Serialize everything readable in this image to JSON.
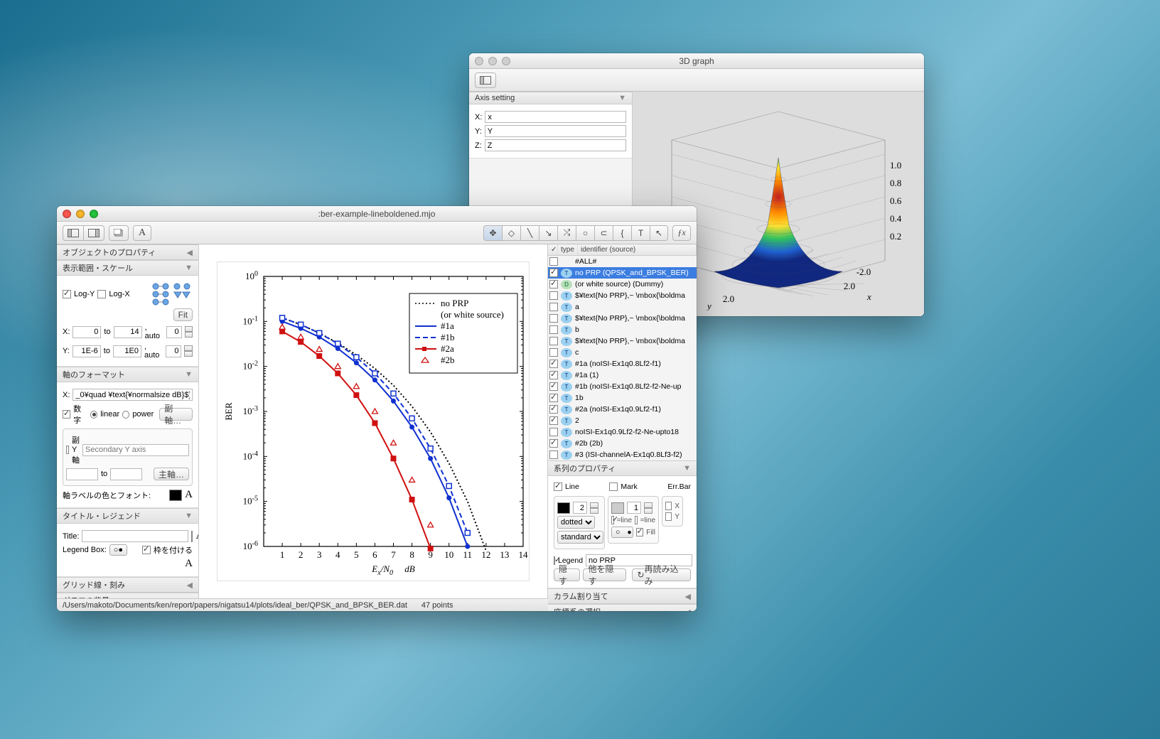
{
  "main_window": {
    "title": ":ber-example-lineboldened.mjo",
    "status_path": "/Users/makoto/Documents/ken/report/papers/nigatsu14/plots/ideal_ber/QPSK_and_BPSK_BER.dat",
    "status_points": "47 points"
  },
  "leftpanel": {
    "section_object_props": "オブジェクトのプロパティ",
    "section_range_scale": "表示範囲・スケール",
    "log_y": "Log-Y",
    "log_x": "Log-X",
    "fit_btn": "Fit",
    "x_label": "X:",
    "x_from": "0",
    "x_to_lbl": "to",
    "x_to": "14",
    "x_auto_lbl": ", auto",
    "x_auto": "0",
    "y_label": "Y:",
    "y_from": "1E-6",
    "y_to": "1E0",
    "y_auto": "0",
    "section_axis_format": "軸のフォーマット",
    "axis_x_lbl": "X:",
    "axis_x_val": "_0¥quad ¥text{¥normalsize dB}$}",
    "number_lbl": "数字",
    "linear_lbl": "linear",
    "power_lbl": "power",
    "subaxis_btn": "副軸…",
    "secondary_y_chk": "副Y軸",
    "secondary_y_placeholder": "Secondary Y axis",
    "to_lbl": "to",
    "mainaxis_btn": "主軸…",
    "axis_label_color_font": "軸ラベルの色とフォント:",
    "section_title_legend": "タイトル・レジェンド",
    "title_lbl": "Title:",
    "legend_box_lbl": "Legend Box:",
    "frame_chk": "枠を付ける",
    "section_grid": "グリッド線・刻み",
    "section_bg": "グラフの背景"
  },
  "toolbar": {
    "font_A": "A"
  },
  "tools": {
    "labels": [
      "✥",
      "◇",
      "╲",
      "↘",
      "⤭",
      "○",
      "⊂",
      "{",
      "T",
      "↖",
      "ƒx"
    ]
  },
  "objlist": {
    "col_chk": "✓",
    "col_type": "type",
    "col_id": "identifier (source)",
    "rows": [
      {
        "chk": false,
        "type": "",
        "label": "#ALL#"
      },
      {
        "chk": true,
        "type": "t",
        "label": "no PRP (QPSK_and_BPSK_BER)",
        "sel": true
      },
      {
        "chk": true,
        "type": "d",
        "label": "(or white source) (Dummy)"
      },
      {
        "chk": false,
        "type": "t",
        "label": "$¥text{No PRP},~ \\mbox{\\boldma"
      },
      {
        "chk": false,
        "type": "t",
        "label": "a"
      },
      {
        "chk": false,
        "type": "t",
        "label": "$¥text{No PRP},~ \\mbox{\\boldma"
      },
      {
        "chk": false,
        "type": "t",
        "label": "b"
      },
      {
        "chk": false,
        "type": "t",
        "label": "$¥text{No PRP},~ \\mbox{\\boldma"
      },
      {
        "chk": false,
        "type": "t",
        "label": "c"
      },
      {
        "chk": true,
        "type": "t",
        "label": "#1a (noISI-Ex1q0.8Lf2-f1)"
      },
      {
        "chk": true,
        "type": "t",
        "label": "#1a (1)"
      },
      {
        "chk": true,
        "type": "t",
        "label": "#1b (noISI-Ex1q0.8Lf2-f2-Ne-up"
      },
      {
        "chk": true,
        "type": "t",
        "label": "1b"
      },
      {
        "chk": true,
        "type": "t",
        "label": "#2a (noISI-Ex1q0.9Lf2-f1)"
      },
      {
        "chk": true,
        "type": "t",
        "label": "2"
      },
      {
        "chk": false,
        "type": "t",
        "label": "noISI-Ex1q0.9Lf2-f2-Ne-upto18"
      },
      {
        "chk": true,
        "type": "t",
        "label": "#2b (2b)"
      },
      {
        "chk": false,
        "type": "t",
        "label": "#3 (ISI-channelA-Ex1q0.8Lf3-f2)"
      }
    ]
  },
  "seriesprops": {
    "header": "系列のプロパティ",
    "line_chk": "Line",
    "mark_chk": "Mark",
    "errbar_lbl": "Err.Bar",
    "width_val": "2",
    "mark_size": "1",
    "eq_line": "=line",
    "style_sel": "dotted",
    "variant_sel": "standard",
    "fill_lbl": "Fill",
    "x_chk": "X",
    "y_chk": "Y",
    "legend_chk": "Legend",
    "legend_val": "no PRP",
    "hide_btn": "隠す",
    "hide_others": "他を隠す",
    "reload": "再読み込み",
    "col_assign": "カラム割り当て",
    "coord_sel": "座標系の選択"
  },
  "win3d": {
    "title": "3D graph",
    "axis_setting": "Axis setting",
    "x_lbl": "X:",
    "x_val": "x",
    "y_lbl": "Y:",
    "y_val": "Y",
    "z_lbl": "Z:",
    "z_val": "Z",
    "ticks": [
      "-2.0",
      "2.0",
      "0.2",
      "0.4",
      "0.6",
      "0.8",
      "1.0"
    ]
  },
  "chart_data": {
    "type": "line",
    "title": "",
    "xlabel": "E_x/N_0    dB",
    "ylabel": "BER",
    "xlim": [
      0,
      14
    ],
    "ylim": [
      1e-06,
      1
    ],
    "yscale": "log",
    "x": [
      1,
      2,
      3,
      4,
      5,
      6,
      7,
      8,
      9,
      10,
      11,
      12,
      13,
      14
    ],
    "series": [
      {
        "name": "no PRP",
        "style": "dotted",
        "color": "#000",
        "values": [
          0.12,
          0.085,
          0.055,
          0.033,
          0.018,
          0.009,
          0.0038,
          0.0013,
          0.00035,
          7e-05,
          1e-05,
          8e-07,
          null,
          null
        ]
      },
      {
        "name": "(or white source)",
        "style": "text",
        "color": "#000",
        "values": null
      },
      {
        "name": "#1a",
        "style": "solid",
        "color": "#1030d0",
        "values": [
          0.1,
          0.07,
          0.045,
          0.025,
          0.012,
          0.005,
          0.0017,
          0.00045,
          9e-05,
          1.2e-05,
          1e-06,
          null,
          null,
          null
        ]
      },
      {
        "name": "#1b",
        "style": "dashed",
        "color": "#1030d0",
        "markers": "square-open",
        "values": [
          0.12,
          0.085,
          0.055,
          0.032,
          0.016,
          0.007,
          0.0025,
          0.0007,
          0.00015,
          2.2e-05,
          2e-06,
          null,
          null,
          null
        ]
      },
      {
        "name": "#2a",
        "style": "solid",
        "color": "#d01010",
        "markers": "square",
        "values": [
          0.06,
          0.035,
          0.017,
          0.007,
          0.0023,
          0.00055,
          9e-05,
          1.1e-05,
          9e-07,
          null,
          null,
          null,
          null,
          null
        ]
      },
      {
        "name": "#2b",
        "style": "markers",
        "color": "#d01010",
        "markers": "triangle-open",
        "values": [
          0.075,
          0.045,
          0.024,
          0.01,
          0.0036,
          0.001,
          0.0002,
          3e-05,
          3e-06,
          null,
          null,
          null,
          null,
          null
        ]
      }
    ],
    "legend_entries": [
      "no PRP",
      "(or white source)",
      "#1a",
      "#1b",
      "#2a",
      "#2b"
    ]
  }
}
